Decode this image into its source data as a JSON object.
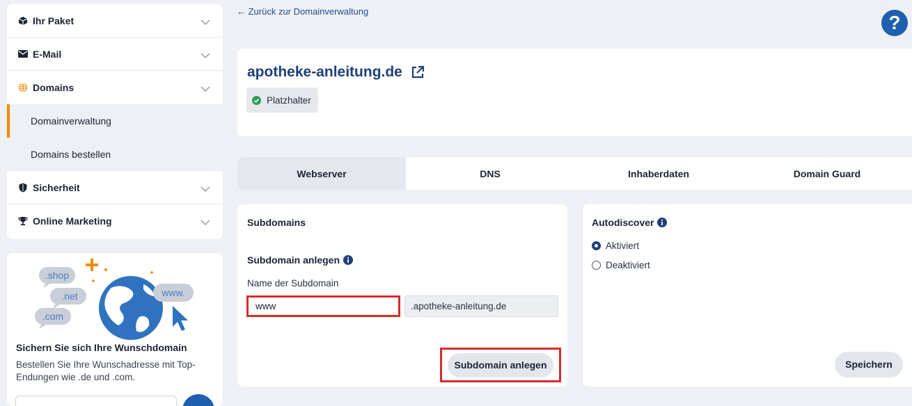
{
  "sidebar": {
    "items": [
      {
        "label": "Ihr Paket",
        "icon": "package-icon"
      },
      {
        "label": "E-Mail",
        "icon": "envelope-icon"
      },
      {
        "label": "Domains",
        "icon": "globe-icon"
      },
      {
        "label": "Sicherheit",
        "icon": "shield-icon"
      },
      {
        "label": "Online Marketing",
        "icon": "trophy-icon"
      }
    ],
    "subitems": [
      {
        "label": "Domainverwaltung",
        "active": true
      },
      {
        "label": "Domains bestellen",
        "active": false
      }
    ],
    "accent_color": "#f08c00"
  },
  "promo": {
    "tags": [
      ".shop",
      ".net",
      ".com",
      "www."
    ],
    "title": "Sichern Sie sich Ihre Wunschdomain",
    "text": "Bestellen Sie Ihre Wunschadresse mit Top-Endungen wie .de und .com."
  },
  "header": {
    "back_link": "← Zurück zur Domainverwaltung",
    "help_label": "?"
  },
  "domain": {
    "name": "apotheke-anleitung.de",
    "status": "Platzhalter",
    "status_color": "#2e9e4f"
  },
  "tabs": [
    {
      "label": "Webserver",
      "active": true
    },
    {
      "label": "DNS",
      "active": false
    },
    {
      "label": "Inhaberdaten",
      "active": false
    },
    {
      "label": "Domain Guard",
      "active": false
    }
  ],
  "subdomains": {
    "heading": "Subdomains",
    "create_heading": "Subdomain anlegen",
    "name_label": "Name der Subdomain",
    "input_value": "www",
    "suffix": ".apotheke-anleitung.de",
    "button_label": "Subdomain anlegen"
  },
  "autodiscover": {
    "heading": "Autodiscover",
    "options": [
      {
        "label": "Aktiviert",
        "selected": true
      },
      {
        "label": "Deaktiviert",
        "selected": false
      }
    ],
    "save_label": "Speichern"
  },
  "highlight_color": "#d62b2b",
  "brand_color": "#1f5fb0"
}
